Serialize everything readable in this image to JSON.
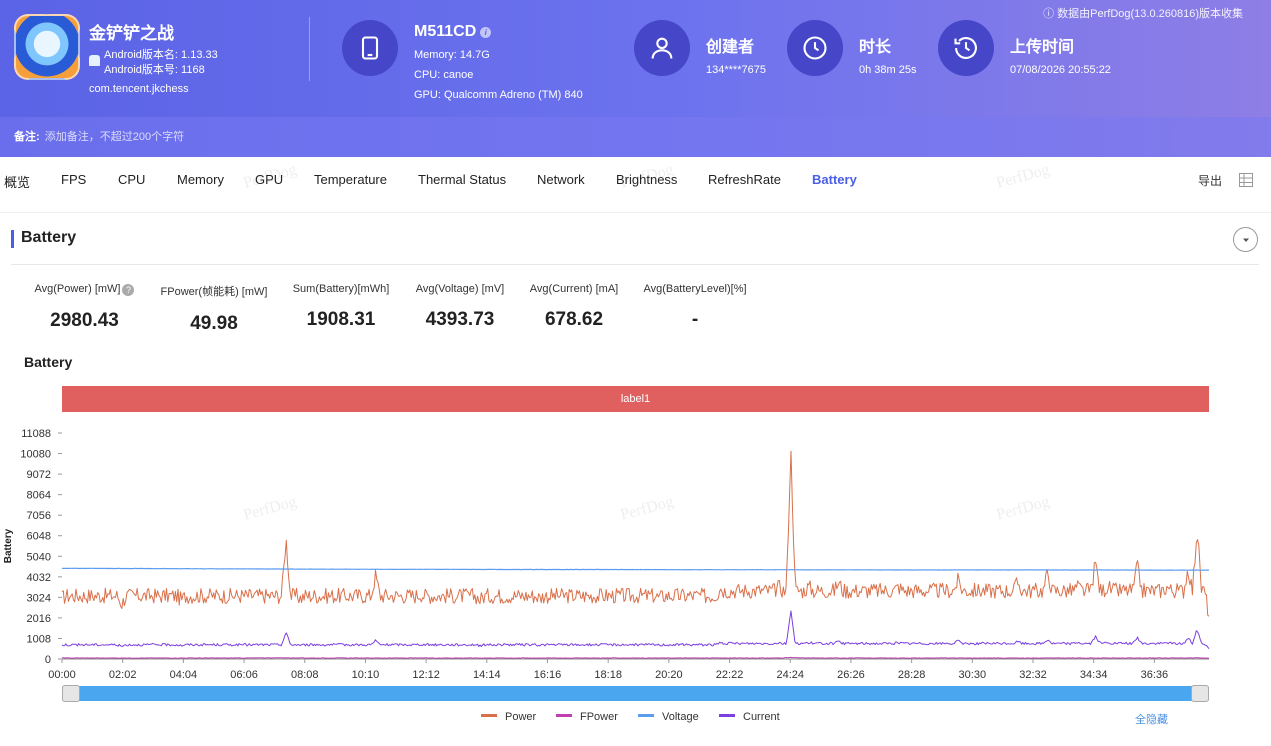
{
  "header": {
    "source_note": "数据由PerfDog(13.0.260816)版本收集",
    "app": {
      "name": "金铲铲之战",
      "version_name": "Android版本名: 1.13.33",
      "version_code": "Android版本号: 1168",
      "package": "com.tencent.jkchess"
    },
    "device": {
      "name": "M511CD",
      "memory": "Memory: 14.7G",
      "cpu": "CPU: canoe",
      "gpu": "GPU: Qualcomm Adreno (TM) 840"
    },
    "creator": {
      "title": "创建者",
      "value": "134****7675"
    },
    "duration": {
      "title": "时长",
      "value": "0h 38m 25s"
    },
    "upload": {
      "title": "上传时间",
      "value": "07/08/2026 20:55:22"
    },
    "note": {
      "label": "备注:",
      "placeholder": "添加备注，不超过200个字符"
    }
  },
  "tabs": [
    "概览",
    "FPS",
    "CPU",
    "Memory",
    "GPU",
    "Temperature",
    "Thermal Status",
    "Network",
    "Brightness",
    "RefreshRate",
    "Battery"
  ],
  "active_tab": "Battery",
  "export_label": "导出",
  "watermark": "PerfDog",
  "panel": {
    "title": "Battery"
  },
  "stats": [
    {
      "label": "Avg(Power) [mW]",
      "value": "2980.43"
    },
    {
      "label": "FPower(帧能耗) [mW]",
      "value": "49.98"
    },
    {
      "label": "Sum(Battery)[mWh]",
      "value": "1908.31"
    },
    {
      "label": "Avg(Voltage) [mV]",
      "value": "4393.73"
    },
    {
      "label": "Avg(Current) [mA]",
      "value": "678.62"
    },
    {
      "label": "Avg(BatteryLevel)[%]",
      "value": "-"
    }
  ],
  "chart_title": "Battery",
  "label_band": "label1",
  "hide_all": "全隐藏",
  "colors": {
    "accent": "#4a5ee8",
    "power": "#d9704a",
    "fpower": "#c040b0",
    "voltage": "#5b9cf0",
    "current": "#7a40e0",
    "label_band": "#e06060"
  },
  "chart_data": {
    "type": "line",
    "title": "Battery",
    "ylabel": "Battery",
    "xlabel": "",
    "ylim": [
      0,
      11088
    ],
    "yticks": [
      0,
      1008,
      2016,
      3024,
      4032,
      5040,
      6048,
      7056,
      8064,
      9072,
      10080,
      11088
    ],
    "xticks": [
      "00:00",
      "02:02",
      "04:04",
      "06:06",
      "08:08",
      "10:10",
      "12:12",
      "14:14",
      "16:16",
      "18:18",
      "20:20",
      "22:22",
      "24:24",
      "26:26",
      "28:28",
      "30:30",
      "32:32",
      "34:34",
      "36:36"
    ],
    "x_minutes": [
      0,
      2,
      4,
      6,
      7.5,
      8,
      10,
      10.5,
      12,
      14,
      16,
      18,
      20,
      22,
      24,
      24.4,
      25,
      26,
      28,
      30,
      32,
      33,
      34,
      34.6,
      35,
      36,
      37,
      37.7,
      38,
      38.4
    ],
    "legend_position": "bottom",
    "grid": false,
    "series": [
      {
        "name": "Power",
        "values": [
          3000,
          2700,
          2900,
          3100,
          5900,
          3000,
          3100,
          4100,
          3200,
          2900,
          3000,
          3100,
          3000,
          3300,
          3300,
          10000,
          3300,
          3500,
          3300,
          3600,
          3500,
          4000,
          3300,
          4500,
          3300,
          4300,
          3300,
          4200,
          6200,
          1900
        ]
      },
      {
        "name": "FPower",
        "values": [
          50,
          50,
          50,
          50,
          60,
          50,
          50,
          50,
          50,
          50,
          50,
          50,
          50,
          50,
          50,
          70,
          50,
          50,
          50,
          50,
          50,
          50,
          50,
          50,
          50,
          50,
          50,
          50,
          60,
          40
        ]
      },
      {
        "name": "Voltage",
        "values": [
          4450,
          4440,
          4430,
          4420,
          4415,
          4410,
          4405,
          4400,
          4400,
          4395,
          4390,
          4390,
          4385,
          4380,
          4380,
          4380,
          4375,
          4375,
          4370,
          4370,
          4370,
          4370,
          4365,
          4365,
          4365,
          4365,
          4360,
          4360,
          4360,
          4360
        ]
      },
      {
        "name": "Current",
        "values": [
          700,
          620,
          660,
          700,
          1300,
          680,
          690,
          900,
          720,
          660,
          680,
          700,
          680,
          740,
          740,
          2300,
          750,
          790,
          750,
          820,
          800,
          900,
          760,
          1050,
          760,
          980,
          760,
          960,
          1400,
          450
        ]
      }
    ]
  }
}
